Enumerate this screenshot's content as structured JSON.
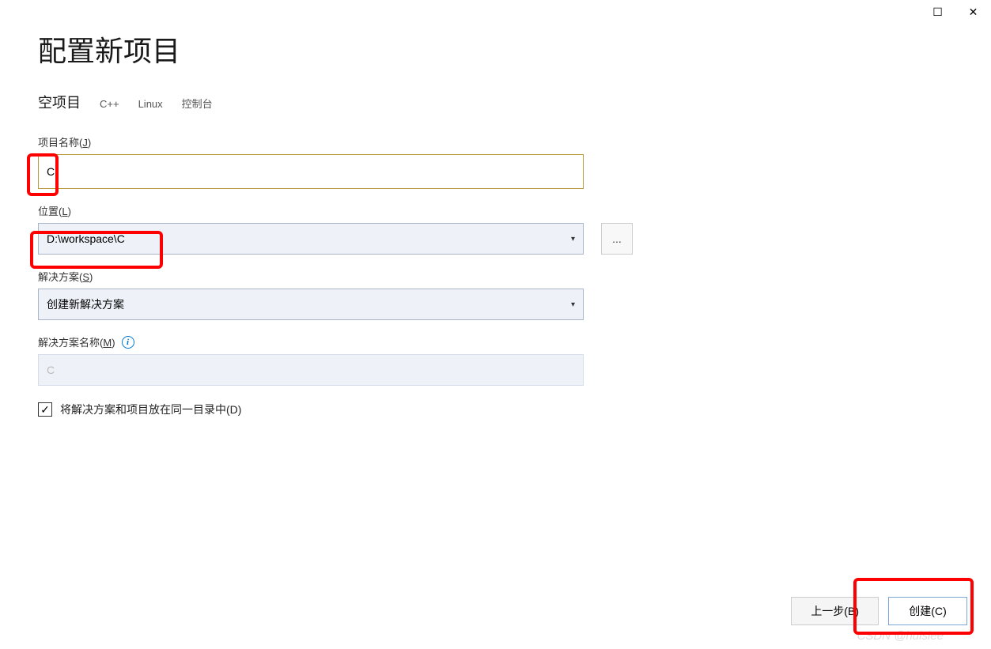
{
  "window": {
    "maximize_glyph": "☐",
    "close_glyph": "✕"
  },
  "header": {
    "title": "配置新项目",
    "template_name": "空项目",
    "tags": [
      "C++",
      "Linux",
      "控制台"
    ]
  },
  "fields": {
    "project_name": {
      "label_prefix": "项目名称(",
      "label_hotkey": "J",
      "label_suffix": ")",
      "value": "C"
    },
    "location": {
      "label_prefix": "位置(",
      "label_hotkey": "L",
      "label_suffix": ")",
      "value": "D:\\workspace\\C",
      "browse_label": "..."
    },
    "solution": {
      "label_prefix": "解决方案(",
      "label_hotkey": "S",
      "label_suffix": ")",
      "value": "创建新解决方案"
    },
    "solution_name": {
      "label_prefix": "解决方案名称(",
      "label_hotkey": "M",
      "label_suffix": ")",
      "value": "C",
      "info_glyph": "i"
    },
    "same_dir": {
      "checked_glyph": "✓",
      "label_prefix": "将解决方案和项目放在同一目录中(",
      "label_hotkey": "D",
      "label_suffix": ")"
    }
  },
  "footer": {
    "back_prefix": "上一步(",
    "back_hotkey": "B",
    "back_suffix": ")",
    "create_prefix": "创建(",
    "create_hotkey": "C",
    "create_suffix": ")"
  },
  "caret": "▾",
  "watermark": "CSDN @huislee"
}
